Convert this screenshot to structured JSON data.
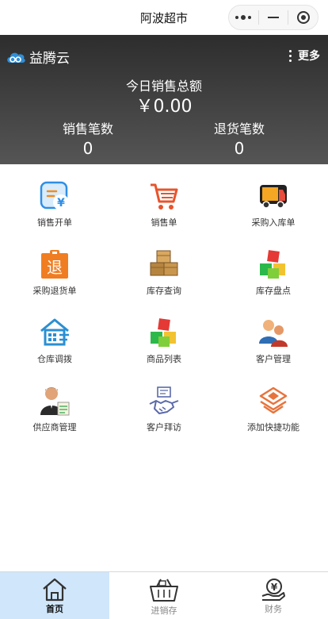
{
  "window": {
    "title": "阿波超市"
  },
  "brand": {
    "name": "益腾云"
  },
  "header": {
    "more_label": "更多",
    "total_label": "今日销售总额",
    "total_value": "￥0.00",
    "sales_count_label": "销售笔数",
    "sales_count_value": "0",
    "return_count_label": "退货笔数",
    "return_count_value": "0"
  },
  "grid": {
    "items": [
      {
        "label": "销售开单",
        "icon": "sales-order-icon"
      },
      {
        "label": "销售单",
        "icon": "cart-icon"
      },
      {
        "label": "采购入库单",
        "icon": "truck-icon"
      },
      {
        "label": "采购退货单",
        "icon": "return-tag-icon"
      },
      {
        "label": "库存查询",
        "icon": "boxes-icon"
      },
      {
        "label": "库存盘点",
        "icon": "cubes-icon"
      },
      {
        "label": "仓库调拨",
        "icon": "warehouse-icon"
      },
      {
        "label": "商品列表",
        "icon": "cubes-icon"
      },
      {
        "label": "客户管理",
        "icon": "customers-icon"
      },
      {
        "label": "供应商管理",
        "icon": "supplier-icon"
      },
      {
        "label": "客户拜访",
        "icon": "handshake-icon"
      },
      {
        "label": "添加快捷功能",
        "icon": "layers-icon"
      }
    ]
  },
  "tabbar": {
    "tabs": [
      {
        "label": "首页",
        "active": true
      },
      {
        "label": "进销存",
        "active": false
      },
      {
        "label": "财务",
        "active": false
      }
    ]
  },
  "colors": {
    "active_tab_bg": "#cfe6fb",
    "header_dark": "#2d2d2d"
  }
}
